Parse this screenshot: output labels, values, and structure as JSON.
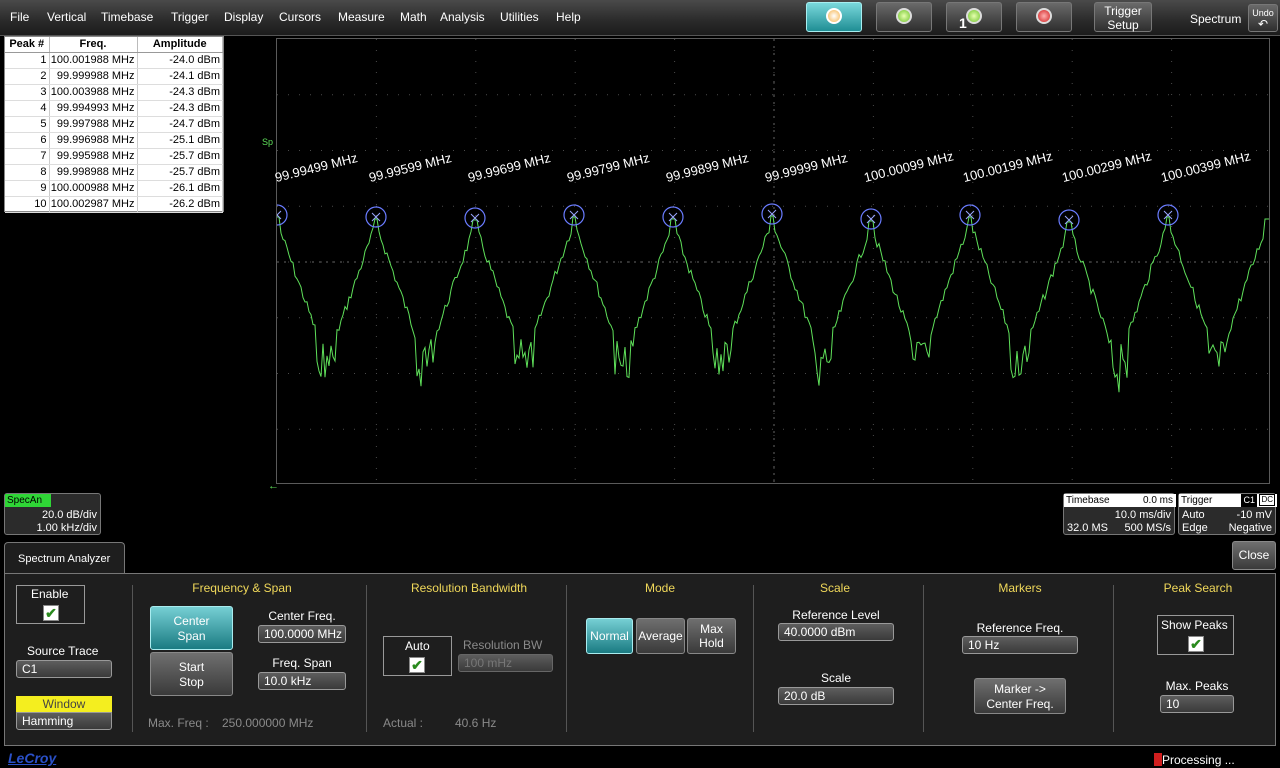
{
  "menu": [
    "File",
    "Vertical",
    "Timebase",
    "Trigger",
    "Display",
    "Cursors",
    "Measure",
    "Math",
    "Analysis",
    "Utilities",
    "Help"
  ],
  "toolbar": {
    "trigger_setup_line1": "Trigger",
    "trigger_setup_line2": "Setup",
    "mode_title": "Spectrum",
    "undo_label": "Undo",
    "single_label": "1"
  },
  "peak_table": {
    "headers": [
      "Peak #",
      "Freq.",
      "Amplitude"
    ],
    "rows": [
      [
        "1",
        "100.001988 MHz",
        "-24.0 dBm"
      ],
      [
        "2",
        "99.999988 MHz",
        "-24.1 dBm"
      ],
      [
        "3",
        "100.003988 MHz",
        "-24.3 dBm"
      ],
      [
        "4",
        "99.994993 MHz",
        "-24.3 dBm"
      ],
      [
        "5",
        "99.997988 MHz",
        "-24.7 dBm"
      ],
      [
        "6",
        "99.996988 MHz",
        "-25.1 dBm"
      ],
      [
        "7",
        "99.995988 MHz",
        "-25.7 dBm"
      ],
      [
        "8",
        "99.998988 MHz",
        "-25.7 dBm"
      ],
      [
        "9",
        "100.000988 MHz",
        "-26.1 dBm"
      ],
      [
        "10",
        "100.002987 MHz",
        "-26.2 dBm"
      ]
    ]
  },
  "plot": {
    "trace_marker": "Sp",
    "peak_labels": [
      "99.99499 MHz",
      "99.99599 MHz",
      "99.99699 MHz",
      "99.99799 MHz",
      "99.99899 MHz",
      "99.99999 MHz",
      "100.00099 MHz",
      "100.00199 MHz",
      "100.00299 MHz",
      "100.00399 MHz"
    ],
    "trace_color": "#5fe05a"
  },
  "specan_desc": {
    "tag": "SpecAn",
    "vdiv": "20.0 dB/div",
    "hdiv": "1.00 kHz/div"
  },
  "timebase_desc": {
    "title": "Timebase",
    "delay": "0.0 ms",
    "tdiv": "10.0 ms/div",
    "samples": "32.0 MS",
    "rate": "500 MS/s"
  },
  "trigger_desc": {
    "title": "Trigger",
    "ch": "C1",
    "coupling": "DC",
    "mode": "Auto",
    "level": "-10 mV",
    "type": "Edge",
    "slope": "Negative"
  },
  "panel": {
    "tab": "Spectrum Analyzer",
    "close": "Close",
    "enable_label": "Enable",
    "source_trace_label": "Source Trace",
    "source_trace_value": "C1",
    "window_label": "Window",
    "window_value": "Hamming",
    "freq_span": {
      "title": "Frequency & Span",
      "center_span_1": "Center",
      "center_span_2": "Span",
      "start_stop_1": "Start",
      "start_stop_2": "Stop",
      "center_freq_label": "Center Freq.",
      "center_freq_value": "100.0000 MHz",
      "freq_span_label": "Freq. Span",
      "freq_span_value": "10.0 kHz",
      "max_freq_label": "Max. Freq :",
      "max_freq_value": "250.000000 MHz"
    },
    "rbw": {
      "title": "Resolution Bandwidth",
      "auto_label": "Auto",
      "rbw_label": "Resolution BW",
      "rbw_value": "100 mHz",
      "actual_label": "Actual :",
      "actual_value": "40.6 Hz"
    },
    "mode": {
      "title": "Mode",
      "normal": "Normal",
      "average": "Average",
      "maxhold_1": "Max",
      "maxhold_2": "Hold"
    },
    "scale": {
      "title": "Scale",
      "ref_level_label": "Reference Level",
      "ref_level_value": "40.0000 dBm",
      "scale_label": "Scale",
      "scale_value": "20.0 dB"
    },
    "markers": {
      "title": "Markers",
      "ref_freq_label": "Reference Freq.",
      "ref_freq_value": "10 Hz",
      "marker_btn_1": "Marker ->",
      "marker_btn_2": "Center Freq."
    },
    "peak_search": {
      "title": "Peak Search",
      "show_peaks_label": "Show Peaks",
      "max_peaks_label": "Max. Peaks",
      "max_peaks_value": "10"
    }
  },
  "status": {
    "brand": "LeCroy",
    "processing": "Processing ..."
  }
}
